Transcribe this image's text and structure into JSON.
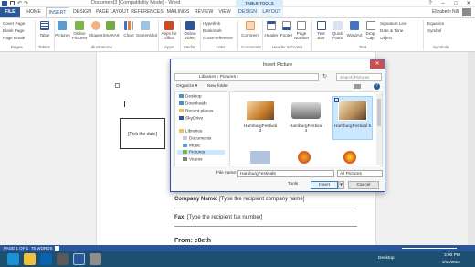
{
  "window": {
    "title": "Document3 [Compatibility Mode] - Word",
    "context_tab": "TABLE TOOLS",
    "user": "Elizabeth Nill"
  },
  "tabs": [
    "FILE",
    "HOME",
    "INSERT",
    "DESIGN",
    "PAGE LAYOUT",
    "REFERENCES",
    "MAILINGS",
    "REVIEW",
    "VIEW",
    "DESIGN",
    "LAYOUT"
  ],
  "ribbon": {
    "pages": [
      "Cover Page",
      "Blank Page",
      "Page Break"
    ],
    "buttons": [
      "Table",
      "Pictures",
      "Online Pictures",
      "Shapes",
      "SmartArt",
      "Chart",
      "Screenshot",
      "Apps for Office",
      "Online Video",
      "Comment",
      "Header",
      "Footer",
      "Page Number",
      "Text Box",
      "Quick Parts",
      "WordArt",
      "Drop Cap",
      "Equation",
      "Symbol"
    ],
    "links": [
      "Hyperlink",
      "Bookmark",
      "Cross-reference"
    ],
    "text_small": [
      "Signature Line",
      "Date & Time",
      "Object"
    ],
    "groups": [
      "Pages",
      "Tables",
      "Illustrations",
      "Apps",
      "Media",
      "Links",
      "Comments",
      "Header & Footer",
      "Text",
      "Symbols"
    ]
  },
  "document": {
    "date_placeholder": "[Pick the date]",
    "company_label": "Company Name:",
    "company_value": "[Type the recipient company name]",
    "fax_label": "Fax:",
    "fax_value": "[Type the recipient fax number]",
    "from_label": "From: e8eth"
  },
  "dialog": {
    "title": "Insert Picture",
    "address": "Libraries › Pictures ›",
    "search_placeholder": "Search Pictures",
    "organize": "Organize ▾",
    "new_folder": "New folder",
    "nav": [
      "Desktop",
      "Downloads",
      "Recent places",
      "SkyDrive",
      "Libraries",
      "Documents",
      "Music",
      "Pictures",
      "Videos"
    ],
    "files": [
      {
        "name": "HamburgFestival 3"
      },
      {
        "name": "HamburgFestival 4"
      },
      {
        "name": "HamburgFestival 5"
      }
    ],
    "file_name_label": "File name:",
    "file_name_value": "HamburgFestival5",
    "file_type_value": "All Pictures",
    "tools": "Tools",
    "insert": "Insert",
    "cancel": "Cancel"
  },
  "status": {
    "page": "PAGE 1 OF 1",
    "words": "75 WORDS"
  },
  "taskbar": {
    "desktop": "Desktop",
    "time": "3:00 PM",
    "date": "3/11/2013"
  }
}
